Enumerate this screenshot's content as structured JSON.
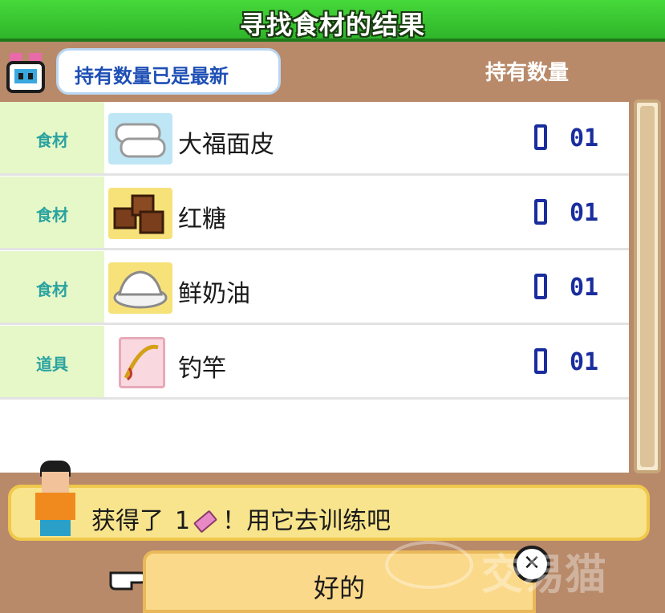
{
  "title": "寻找食材的结果",
  "header": {
    "bubble_text": "持有数量已是最新",
    "quantity_column_label": "持有数量"
  },
  "items": [
    {
      "category": "食材",
      "name": "大福面皮",
      "icon": "mochi-wrapper-icon",
      "quantity": "01"
    },
    {
      "category": "食材",
      "name": "红糖",
      "icon": "brown-sugar-icon",
      "quantity": "01"
    },
    {
      "category": "食材",
      "name": "鲜奶油",
      "icon": "fresh-cream-icon",
      "quantity": "01"
    },
    {
      "category": "道具",
      "name": "钓竿",
      "icon": "fishing-rod-icon",
      "quantity": "01"
    }
  ],
  "message": {
    "prefix": "获得了",
    "count": "1",
    "suffix": "！用它去训练吧"
  },
  "ok_label": "好的",
  "watermark": "交易猫",
  "colors": {
    "title_bar": "#3ccf34",
    "category_bg": "#e6f7c8",
    "category_text": "#2aa3a0",
    "quantity": "#1a2d9e",
    "message_bg": "#f8e48c",
    "button_bg": "#fbd98a"
  }
}
